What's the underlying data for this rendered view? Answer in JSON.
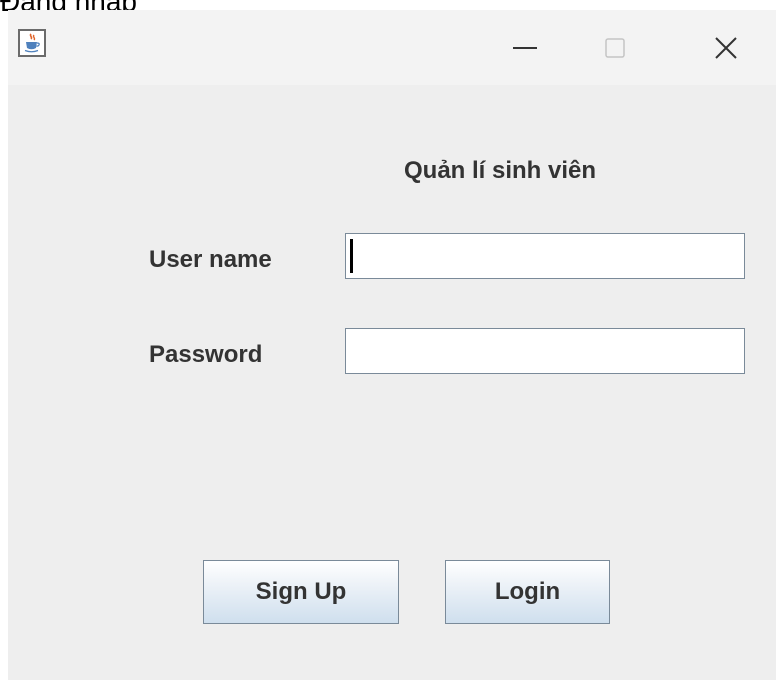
{
  "backdrop": {
    "caption": "Đăng nhập"
  },
  "window": {
    "icon": "java-icon",
    "controls": {
      "minimize_icon": "minimize-icon",
      "maximize_icon": "maximize-icon",
      "close_icon": "close-icon"
    }
  },
  "form": {
    "title": "Quản lí sinh viên",
    "username": {
      "label": "User name",
      "value": ""
    },
    "password": {
      "label": "Password",
      "value": ""
    },
    "buttons": {
      "signup_label": "Sign Up",
      "login_label": "Login"
    }
  },
  "colors": {
    "window_bg": "#eeeeee",
    "titlebar_bg": "#f3f3f3",
    "text": "#333333",
    "field_border": "#7a8a99",
    "button_gradient_bottom": "#cfdfee"
  }
}
